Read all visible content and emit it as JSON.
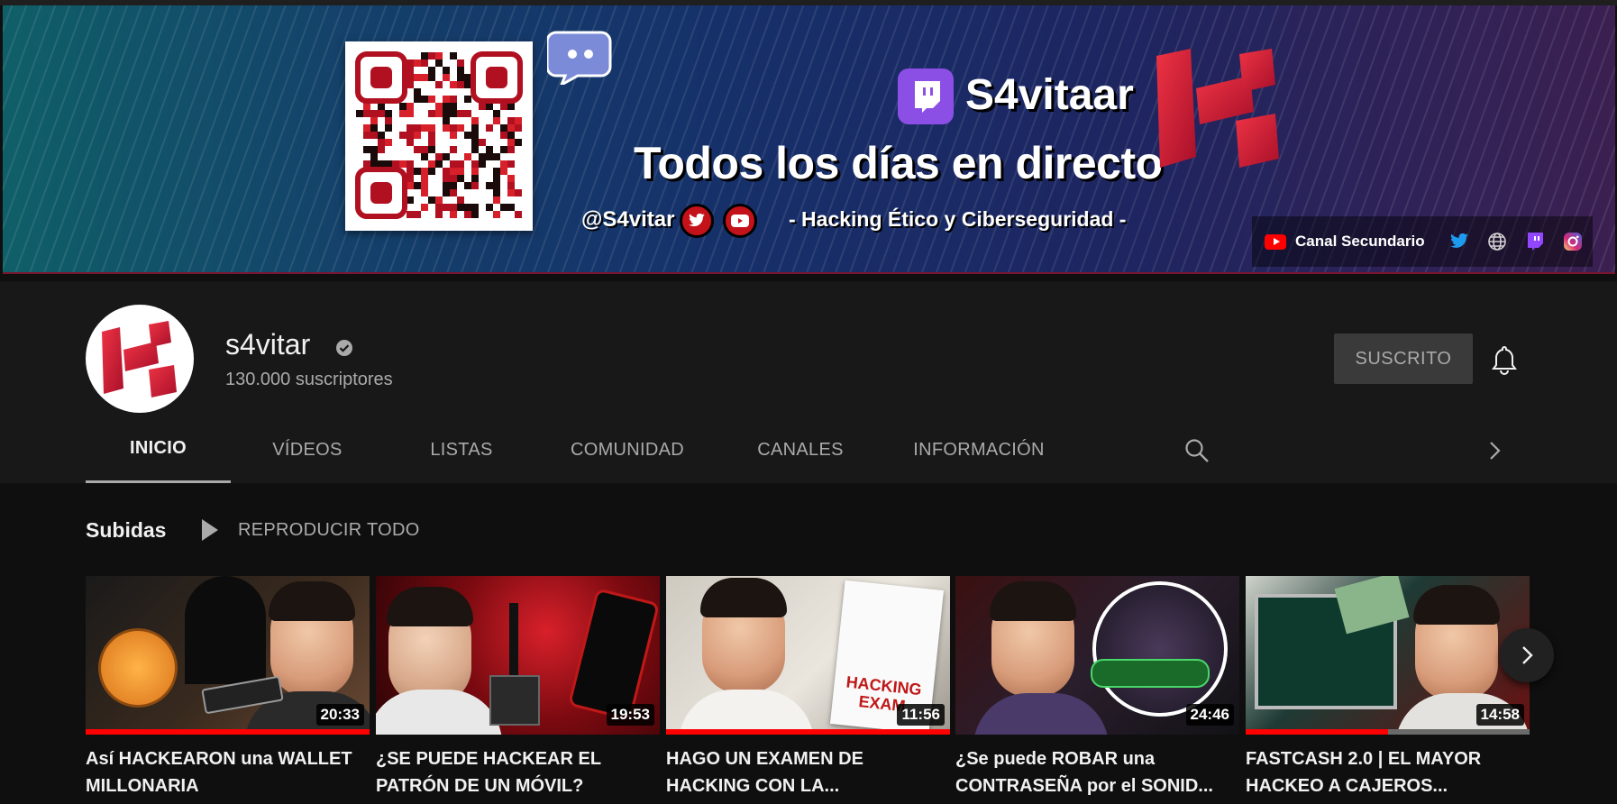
{
  "banner": {
    "brand": "S4vitaar",
    "tagline": "Todos los días en directo",
    "handle": "@S4vitar",
    "subtitle": "- Hacking Ético y Ciberseguridad -",
    "link_label": "Canal Secundario",
    "link_icons": [
      "twitter-icon",
      "globe-icon",
      "twitch-icon",
      "instagram-icon"
    ]
  },
  "channel": {
    "name": "s4vitar",
    "subscribers": "130.000 suscriptores",
    "subscribe_label": "SUSCRITO"
  },
  "tabs": [
    {
      "label": "INICIO",
      "active": true
    },
    {
      "label": "VÍDEOS",
      "active": false
    },
    {
      "label": "LISTAS",
      "active": false
    },
    {
      "label": "COMUNIDAD",
      "active": false
    },
    {
      "label": "CANALES",
      "active": false
    },
    {
      "label": "INFORMACIÓN",
      "active": false
    }
  ],
  "section": {
    "title": "Subidas",
    "play_all": "REPRODUCIR TODO"
  },
  "videos": [
    {
      "title": "Así HACKEARON una WALLET MILLONARIA",
      "duration": "20:33",
      "progress": 1.0,
      "theme": "#3a2a1e",
      "overlay": ""
    },
    {
      "title": "¿SE PUEDE HACKEAR EL PATRÓN DE UN MÓVIL?",
      "duration": "19:53",
      "progress": 0.0,
      "theme": "#5a0d10",
      "overlay": ""
    },
    {
      "title": "HAGO UN EXAMEN DE HACKING CON LA...",
      "duration": "11:56",
      "progress": 1.0,
      "theme": "#d8d4cc",
      "overlay": "HACKING EXAM"
    },
    {
      "title": "¿Se puede ROBAR una CONTRASEÑA por el SONID...",
      "duration": "24:46",
      "progress": 0.0,
      "theme": "#2a1e2c",
      "overlay": ""
    },
    {
      "title": "FASTCASH 2.0 | EL MAYOR HACKEO A CAJEROS...",
      "duration": "14:58",
      "progress": 0.5,
      "theme": "#1e3a34",
      "overlay": ""
    }
  ],
  "colors": {
    "accent_red": "#ff0000",
    "background": "#0f0f0f",
    "header_bg": "#181818"
  }
}
